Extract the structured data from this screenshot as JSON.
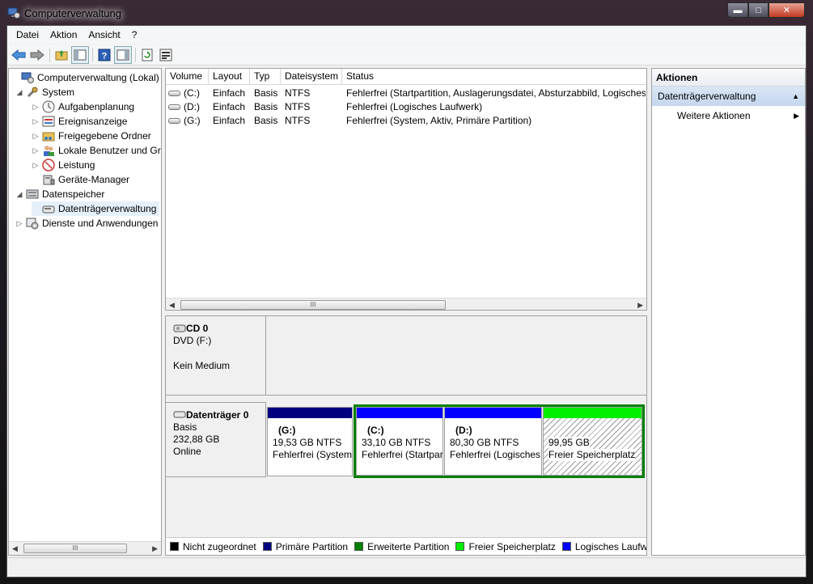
{
  "window": {
    "title": "Computerverwaltung",
    "controls": {
      "minimize": "▬",
      "maximize": "□",
      "close": "✕"
    }
  },
  "menu": [
    "Datei",
    "Aktion",
    "Ansicht",
    "?"
  ],
  "toolbar": [
    "back-icon",
    "forward-icon",
    "up-folder-icon",
    "show-hide-tree-icon",
    "help-icon",
    "properties-icon",
    "refresh-icon",
    "settings-icon"
  ],
  "tree": {
    "root": "Computerverwaltung (Lokal)",
    "system": "System",
    "aufgaben": "Aufgabenplanung",
    "ereignis": "Ereignisanzeige",
    "freigabe": "Freigegebene Ordner",
    "benutzer": "Lokale Benutzer und Gruppen",
    "leistung": "Leistung",
    "geraete": "Geräte-Manager",
    "speicher": "Datenspeicher",
    "datentraeger": "Datenträgerverwaltung",
    "dienste": "Dienste und Anwendungen"
  },
  "volumes": {
    "columns": [
      "Volume",
      "Layout",
      "Typ",
      "Dateisystem",
      "Status"
    ],
    "rows": [
      [
        "(C:)",
        "Einfach",
        "Basis",
        "NTFS",
        "Fehlerfrei (Startpartition, Auslagerungsdatei, Absturzabbild, Logisches Laufwerk)"
      ],
      [
        "(D:)",
        "Einfach",
        "Basis",
        "NTFS",
        "Fehlerfrei (Logisches Laufwerk)"
      ],
      [
        "(G:)",
        "Einfach",
        "Basis",
        "NTFS",
        "Fehlerfrei (System, Aktiv, Primäre Partition)"
      ]
    ]
  },
  "disks": {
    "cd": {
      "name": "CD 0",
      "line1": "DVD (F:)",
      "line2": "Kein Medium"
    },
    "disk0": {
      "name": "Datenträger 0",
      "type": "Basis",
      "size": "232,88 GB",
      "state": "Online",
      "partitions": [
        {
          "title": "(G:)",
          "size": "19,53 GB NTFS",
          "status": "Fehlerfrei (System, Aktiv, Primäre Partition)",
          "color": "#000080"
        },
        {
          "title": "(C:)",
          "size": "33,10 GB NTFS",
          "status": "Fehlerfrei (Startpartition)",
          "color": "#0000ff"
        },
        {
          "title": "(D:)",
          "size": "80,30 GB NTFS",
          "status": "Fehlerfrei (Logisches Laufwerk)",
          "color": "#0000ff"
        },
        {
          "title": "",
          "size": "99,95 GB",
          "status": "Freier Speicherplatz",
          "color": "#00ee00"
        }
      ]
    }
  },
  "legend": [
    {
      "label": "Nicht zugeordnet",
      "color": "#000000"
    },
    {
      "label": "Primäre Partition",
      "color": "#000080"
    },
    {
      "label": "Erweiterte Partition",
      "color": "#008000"
    },
    {
      "label": "Freier Speicherplatz",
      "color": "#00ee00"
    },
    {
      "label": "Logisches Laufwerk",
      "color": "#0000ff"
    }
  ],
  "actions": {
    "header": "Aktionen",
    "section": "Datenträgerverwaltung",
    "more": "Weitere Aktionen"
  }
}
